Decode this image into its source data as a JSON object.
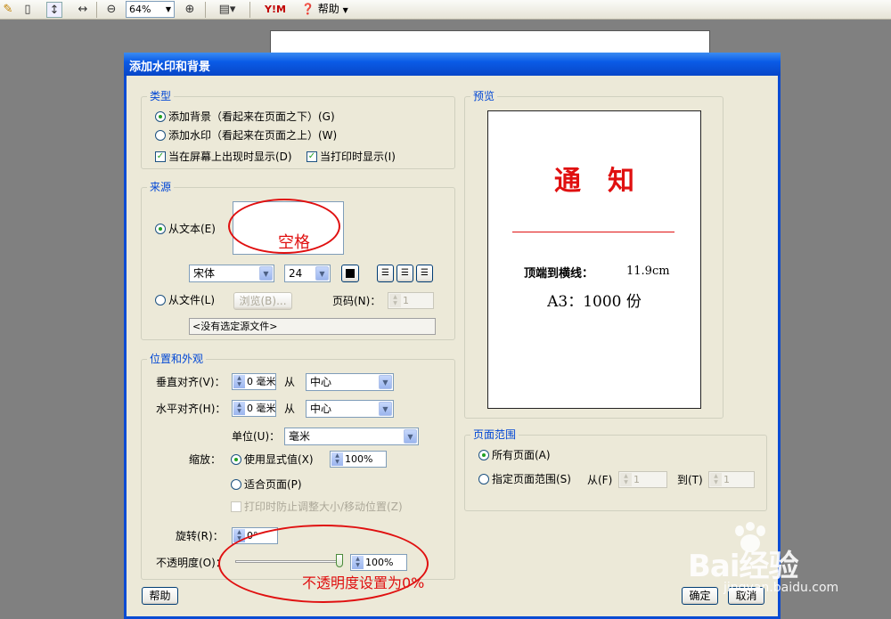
{
  "toolbar": {
    "zoom_value": "64%",
    "help_label": "帮助",
    "brand_glyph": "Y!M"
  },
  "dialog": {
    "title": "添加水印和背景",
    "type_group": {
      "legend": "类型",
      "option_background": "添加背景（看起来在页面之下）(G)",
      "option_watermark": "添加水印（看起来在页面之上）(W)",
      "selected": "background",
      "check_screen": "当在屏幕上出现时显示(D)",
      "check_screen_checked": true,
      "check_print": "当打印时显示(I)",
      "check_print_checked": true
    },
    "source_group": {
      "legend": "来源",
      "from_text_label": "从文本(E)",
      "from_text_selected": true,
      "text_value": "",
      "font_value": "宋体",
      "size_value": "24",
      "from_file_label": "从文件(L)",
      "browse_label": "浏览(B)...",
      "page_number_label": "页码(N)：",
      "page_number_value": "1",
      "no_file_text": "<没有选定源文件>"
    },
    "position_group": {
      "legend": "位置和外观",
      "vertical_label": "垂直对齐(V)：",
      "vertical_offset": "0 毫米",
      "vertical_from_label": "从",
      "vertical_from_value": "中心",
      "horizontal_label": "水平对齐(H)：",
      "horizontal_offset": "0 毫米",
      "horizontal_from_label": "从",
      "horizontal_from_value": "中心",
      "unit_label": "单位(U)：",
      "unit_value": "毫米",
      "scale_label": "缩放：",
      "use_display_label": "使用显式值(X)",
      "use_display_selected": true,
      "scale_value": "100%",
      "fit_page_label": "适合页面(P)",
      "prevent_resize_label": "打印时防止调整大小/移动位置(Z)",
      "rotate_label": "旋转(R)：",
      "rotate_value": "0°",
      "opacity_label": "不透明度(O)：",
      "opacity_value": "100%",
      "opacity_fraction": 1.0
    },
    "preview_group": {
      "legend": "预览",
      "page_title": "通　知",
      "line_label": "顶端到横线：",
      "line_value": "11.9cm",
      "paper_line": "A3：1000 份"
    },
    "page_range_group": {
      "legend": "页面范围",
      "all_pages_label": "所有页面(A)",
      "all_pages_selected": true,
      "specify_label": "指定页面范围(S)",
      "from_label": "从(F)",
      "from_value": "1",
      "to_label": "到(T)",
      "to_value": "1"
    },
    "buttons": {
      "help": "帮助",
      "ok": "确定",
      "cancel": "取消"
    }
  },
  "annotations": {
    "space_note": "空格",
    "opacity_note": "不透明度设置为0%"
  },
  "watermark": {
    "brand": "Bai经验",
    "url": "jingyan.baidu.com"
  },
  "colors": {
    "title_bar": "#0a5be6",
    "group_legend": "#0046d5",
    "annotation_red": "#e01010",
    "preview_red": "#e01010"
  }
}
